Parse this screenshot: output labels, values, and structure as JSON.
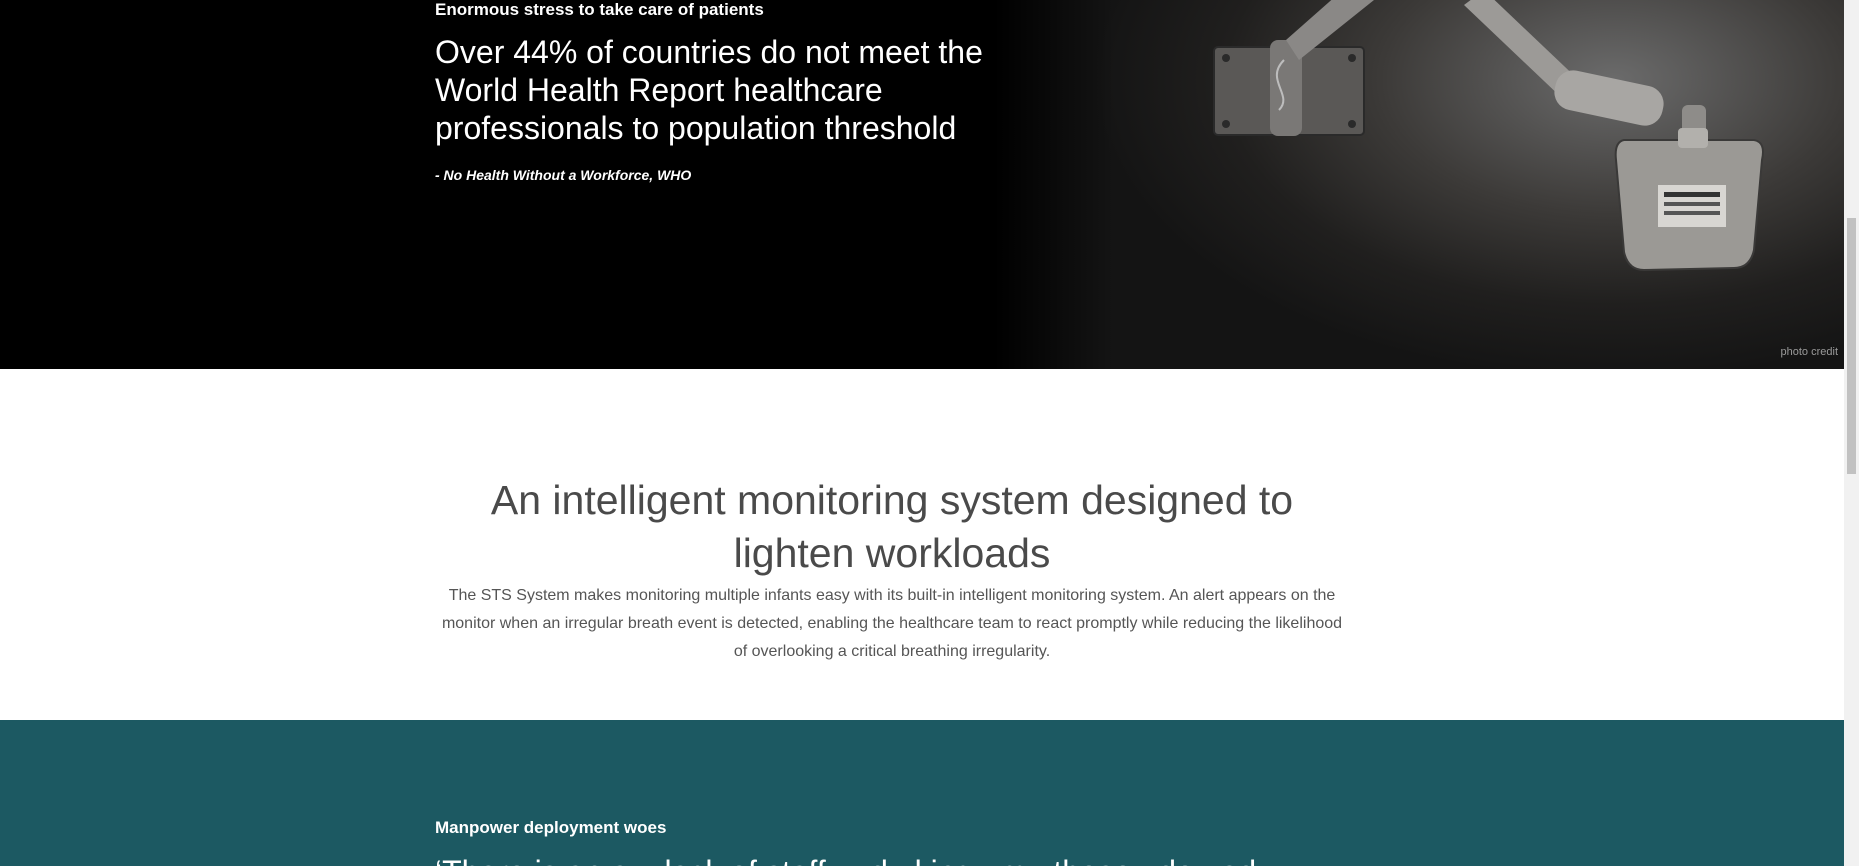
{
  "hero": {
    "eyebrow": "Enormous stress to take care of patients",
    "quote": "Over 44% of countries do not meet the World Health Report healthcare professionals to population threshold",
    "source": "- No Health Without a Workforce, WHO",
    "photo_credit": "photo credit"
  },
  "intro": {
    "title": "An intelligent monitoring system designed to lighten workloads",
    "text": "The STS System makes monitoring multiple infants easy with its built-in intelligent monitoring system. An alert appears on the monitor when an irregular breath event is detected, enabling the healthcare team to react promptly while reducing the likelihood of overlooking a critical breathing irregularity."
  },
  "teal_section": {
    "eyebrow": "Manpower deployment woes",
    "quote_partial": "‘There is an a... lack of staff.. ..d ..king ..m ..those ..do ..ed.."
  },
  "colors": {
    "hero_bg": "#000000",
    "teal_bg": "#1c5962",
    "heading_text": "#4a4a4a"
  }
}
